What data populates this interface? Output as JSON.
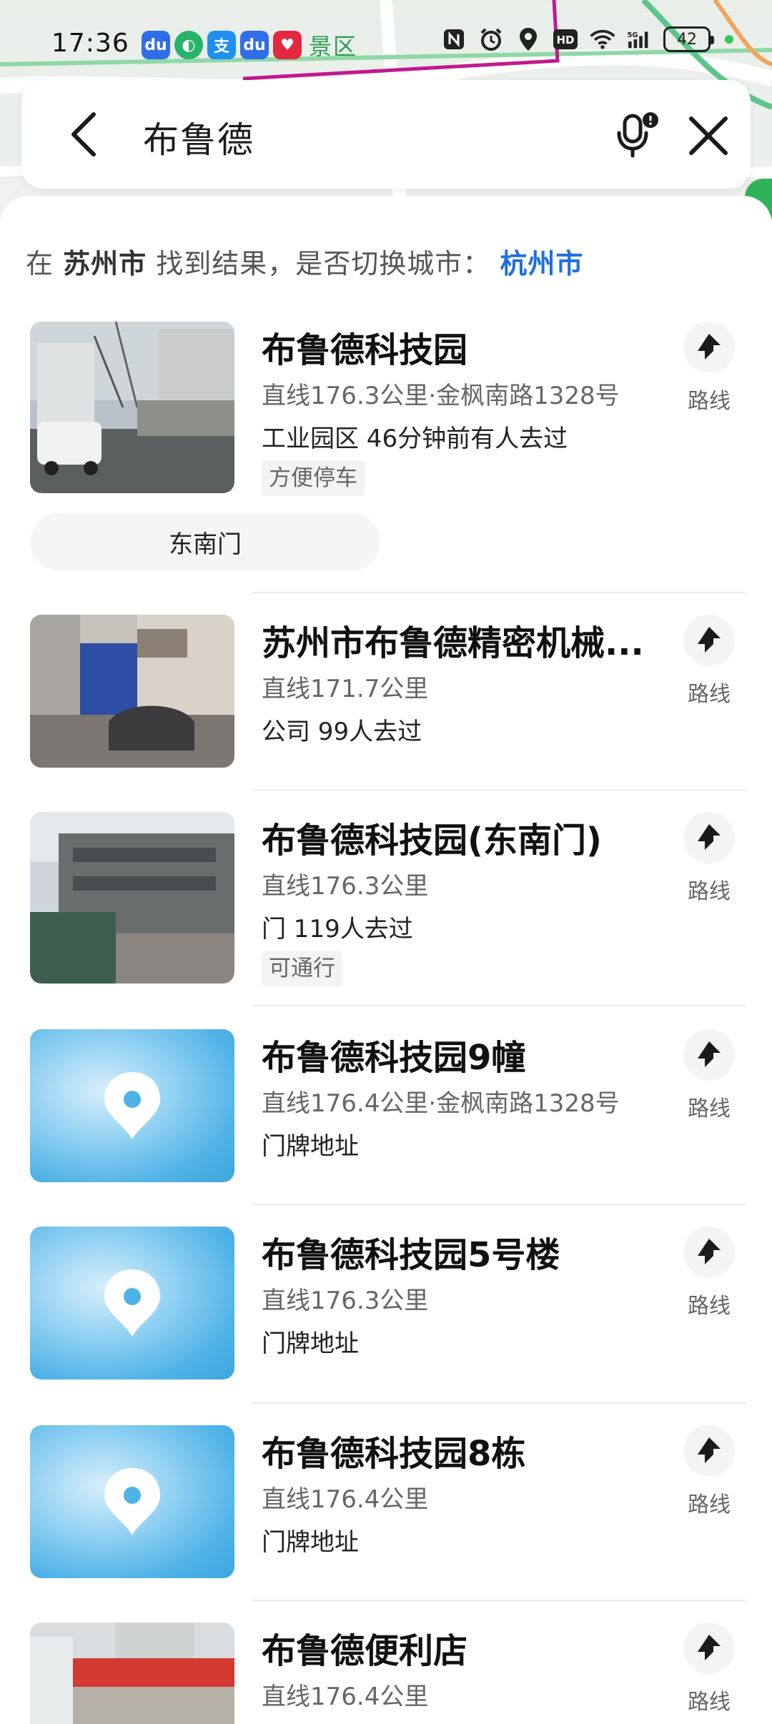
{
  "status_bar": {
    "time": "17:36",
    "scenic_label": "景区",
    "battery": "42",
    "network": "5G"
  },
  "search": {
    "query": "布鲁德"
  },
  "city_hint": {
    "prefix": "在",
    "current_city": "苏州市",
    "middle": "找到结果，是否切换城市：",
    "switch_city": "杭州市"
  },
  "route_label": "路线",
  "results": [
    {
      "title": "布鲁德科技园",
      "distance": "直线176.3公里·金枫南路1328号",
      "info": "工业园区  46分钟前有人去过",
      "tag": "方便停车",
      "sub_chip": "东南门",
      "thumb": "photo-building"
    },
    {
      "title": "苏州市布鲁德精密机械...",
      "distance": "直线171.7公里",
      "info": "公司  99人去过",
      "thumb": "photo-gate"
    },
    {
      "title": "布鲁德科技园(东南门)",
      "distance": "直线176.3公里",
      "info": "门  119人去过",
      "tag": "可通行",
      "thumb": "photo-office"
    },
    {
      "title": "布鲁德科技园9幢",
      "distance": "直线176.4公里·金枫南路1328号",
      "info": "门牌地址",
      "thumb": "pin"
    },
    {
      "title": "布鲁德科技园5号楼",
      "distance": "直线176.3公里",
      "info": "门牌地址",
      "thumb": "pin"
    },
    {
      "title": "布鲁德科技园8栋",
      "distance": "直线176.4公里",
      "info": "门牌地址",
      "thumb": "pin"
    },
    {
      "title": "布鲁德便利店",
      "distance": "直线176.4公里",
      "thumb": "photo-store"
    }
  ],
  "colors": {
    "accent_blue": "#1f6fe0",
    "pin_blue": "#4fb2e6",
    "map_road_purple": "#c2188f",
    "map_road_green": "#5cc68a"
  }
}
